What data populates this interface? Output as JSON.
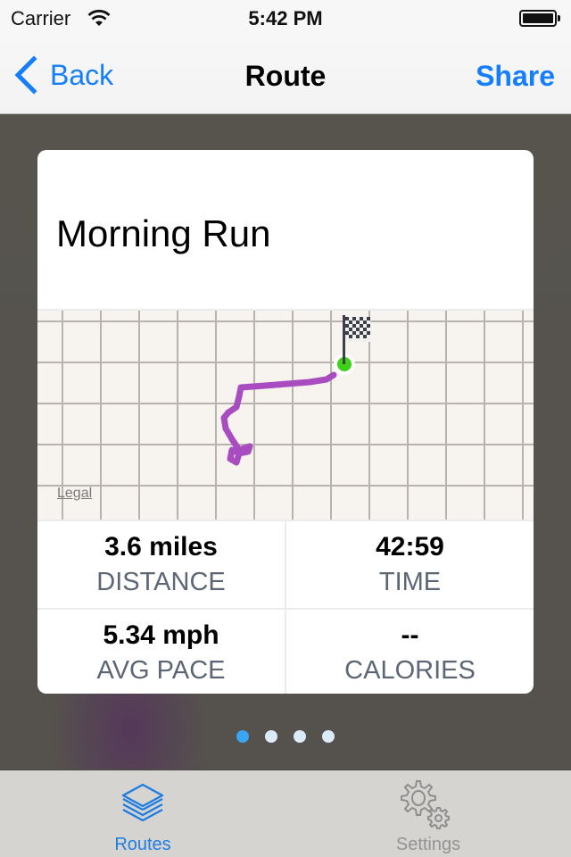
{
  "status_bar": {
    "carrier": "Carrier",
    "time": "5:42 PM",
    "wifi_icon": "wifi-icon",
    "battery_icon": "battery-full-icon"
  },
  "nav": {
    "back_label": "Back",
    "title": "Route",
    "share_label": "Share",
    "back_icon": "chevron-left-icon"
  },
  "card": {
    "title": "Morning Run",
    "map": {
      "legal_label": "Legal",
      "route_color": "#a84cc0",
      "start_marker_color": "#3fd01a",
      "finish_icon": "checkered-flag-icon"
    },
    "stats": [
      {
        "value": "3.6 miles",
        "label": "DISTANCE"
      },
      {
        "value": "42:59",
        "label": "TIME"
      },
      {
        "value": "5.34 mph",
        "label": "AVG PACE"
      },
      {
        "value": "--",
        "label": "CALORIES"
      }
    ]
  },
  "pager": {
    "page_count": 4,
    "current_page": 1,
    "active_color": "#3aa5f5"
  },
  "tab_bar": {
    "tabs": [
      {
        "label": "Routes",
        "icon": "layers-icon",
        "selected": true
      },
      {
        "label": "Settings",
        "icon": "gears-icon",
        "selected": false
      }
    ]
  },
  "colors": {
    "accent": "#157efb",
    "tab_selected": "#1f7de0",
    "tab_unselected": "#939393",
    "stat_label": "#5d6674"
  }
}
